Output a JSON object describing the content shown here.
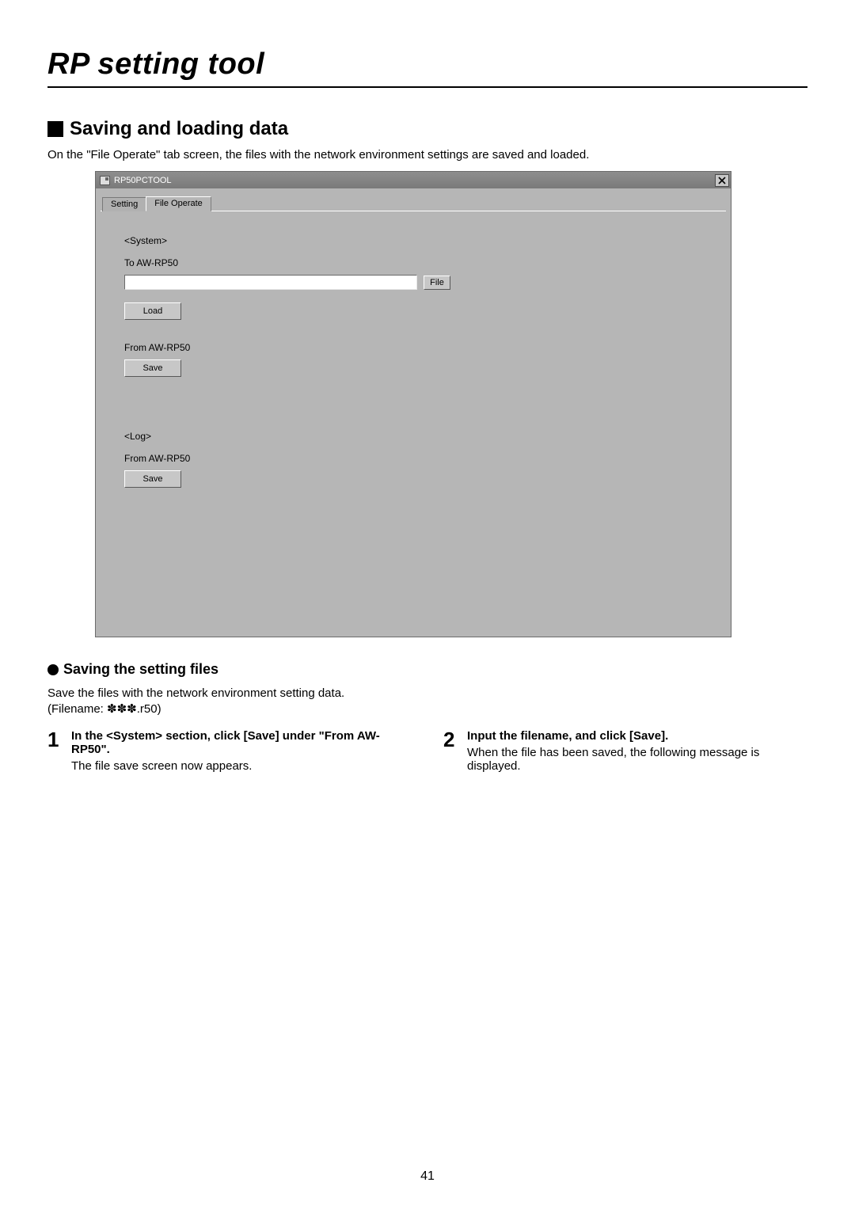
{
  "doc": {
    "title": "RP setting tool",
    "h2": "Saving and loading data",
    "intro": "On the \"File Operate\" tab screen, the files with the network environment settings are saved and loaded.",
    "page_number": "41"
  },
  "app": {
    "window_title": "RP50PCTOOL",
    "tabs": {
      "setting": "Setting",
      "file_operate": "File Operate"
    },
    "system": {
      "heading": "<System>",
      "to_label": "To AW-RP50",
      "file_path_value": "",
      "file_btn": "File",
      "load_btn": "Load",
      "from_label": "From AW-RP50",
      "save_btn": "Save"
    },
    "log": {
      "heading": "<Log>",
      "from_label": "From AW-RP50",
      "save_btn": "Save"
    }
  },
  "sub": {
    "heading": "Saving the setting files",
    "para1": "Save the files with the network environment setting data.",
    "para2": "(Filename: ✽✽✽.r50)",
    "step1_num": "1",
    "step1_title": "In the <System> section, click [Save] under \"From AW-RP50\".",
    "step1_body": "The file save screen now appears.",
    "step2_num": "2",
    "step2_title": "Input the filename, and click [Save].",
    "step2_body": "When the file has been saved, the following message is displayed."
  }
}
